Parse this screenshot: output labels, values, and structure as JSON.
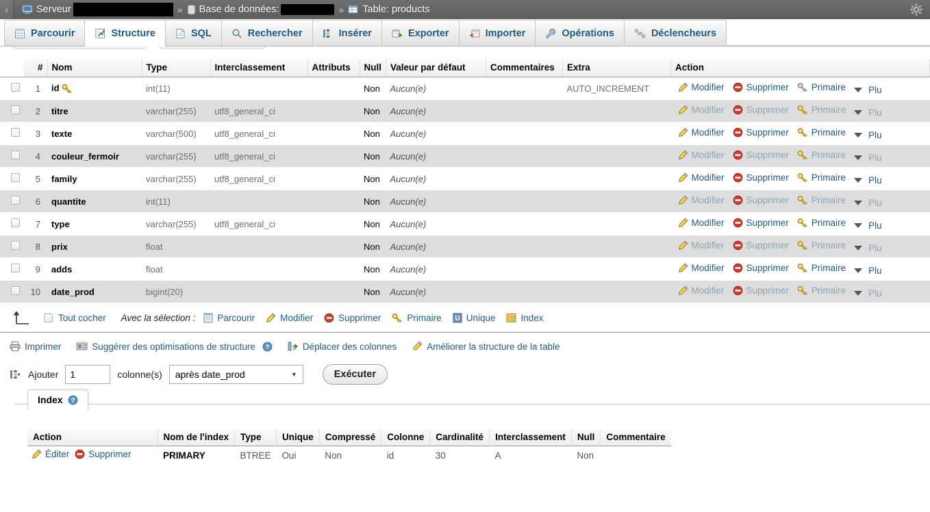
{
  "breadcrumb": {
    "back_label": "‹",
    "server_label": "Serveur",
    "server_value_redacted": true,
    "database_label": "Base de données:",
    "database_value_redacted": true,
    "table_label": "Table: products",
    "separator": "»",
    "settings_icon": "gear-icon"
  },
  "tabs": [
    {
      "label": "Parcourir",
      "icon": "browse-icon",
      "active": false
    },
    {
      "label": "Structure",
      "icon": "structure-icon",
      "active": true
    },
    {
      "label": "SQL",
      "icon": "sql-icon",
      "active": false
    },
    {
      "label": "Rechercher",
      "icon": "search-icon",
      "active": false
    },
    {
      "label": "Insérer",
      "icon": "insert-icon",
      "active": false
    },
    {
      "label": "Exporter",
      "icon": "export-icon",
      "active": false
    },
    {
      "label": "Importer",
      "icon": "import-icon",
      "active": false
    },
    {
      "label": "Opérations",
      "icon": "wrench-icon",
      "active": false
    },
    {
      "label": "Déclencheurs",
      "icon": "trigger-icon",
      "active": false
    }
  ],
  "structure_table": {
    "headers": [
      "",
      "#",
      "Nom",
      "Type",
      "Interclassement",
      "Attributs",
      "Null",
      "Valeur par défaut",
      "Commentaires",
      "Extra",
      "Action"
    ],
    "rows": [
      {
        "num": "1",
        "name": "id",
        "key": true,
        "type": "int(11)",
        "collation": "",
        "attributes": "",
        "null": "Non",
        "default": "Aucun(e)",
        "comments": "",
        "extra": "AUTO_INCREMENT",
        "primary_dim": true
      },
      {
        "num": "2",
        "name": "titre",
        "key": false,
        "type": "varchar(255)",
        "collation": "utf8_general_ci",
        "attributes": "",
        "null": "Non",
        "default": "Aucun(e)",
        "comments": "",
        "extra": "",
        "primary_dim": false
      },
      {
        "num": "3",
        "name": "texte",
        "key": false,
        "type": "varchar(500)",
        "collation": "utf8_general_ci",
        "attributes": "",
        "null": "Non",
        "default": "Aucun(e)",
        "comments": "",
        "extra": "",
        "primary_dim": false
      },
      {
        "num": "4",
        "name": "couleur_fermoir",
        "key": false,
        "type": "varchar(255)",
        "collation": "utf8_general_ci",
        "attributes": "",
        "null": "Non",
        "default": "Aucun(e)",
        "comments": "",
        "extra": "",
        "primary_dim": false
      },
      {
        "num": "5",
        "name": "family",
        "key": false,
        "type": "varchar(255)",
        "collation": "utf8_general_ci",
        "attributes": "",
        "null": "Non",
        "default": "Aucun(e)",
        "comments": "",
        "extra": "",
        "primary_dim": false
      },
      {
        "num": "6",
        "name": "quantite",
        "key": false,
        "type": "int(11)",
        "collation": "",
        "attributes": "",
        "null": "Non",
        "default": "Aucun(e)",
        "comments": "",
        "extra": "",
        "primary_dim": false
      },
      {
        "num": "7",
        "name": "type",
        "key": false,
        "type": "varchar(255)",
        "collation": "utf8_general_ci",
        "attributes": "",
        "null": "Non",
        "default": "Aucun(e)",
        "comments": "",
        "extra": "",
        "primary_dim": false
      },
      {
        "num": "8",
        "name": "prix",
        "key": false,
        "type": "float",
        "collation": "",
        "attributes": "",
        "null": "Non",
        "default": "Aucun(e)",
        "comments": "",
        "extra": "",
        "primary_dim": false
      },
      {
        "num": "9",
        "name": "adds",
        "key": false,
        "type": "float",
        "collation": "",
        "attributes": "",
        "null": "Non",
        "default": "Aucun(e)",
        "comments": "",
        "extra": "",
        "primary_dim": false
      },
      {
        "num": "10",
        "name": "date_prod",
        "key": false,
        "type": "bigint(20)",
        "collation": "",
        "attributes": "",
        "null": "Non",
        "default": "Aucun(e)",
        "comments": "",
        "extra": "",
        "primary_dim": false
      }
    ],
    "row_actions": {
      "edit": "Modifier",
      "drop": "Supprimer",
      "primary": "Primaire",
      "more": "Plu"
    }
  },
  "selection_bar": {
    "check_all": "Tout cocher",
    "with_selected": "Avec la sélection :",
    "actions": [
      {
        "label": "Parcourir",
        "icon": "browse-icon"
      },
      {
        "label": "Modifier",
        "icon": "pencil-icon"
      },
      {
        "label": "Supprimer",
        "icon": "delete-icon"
      },
      {
        "label": "Primaire",
        "icon": "key-icon"
      },
      {
        "label": "Unique",
        "icon": "unique-icon"
      },
      {
        "label": "Index",
        "icon": "index-icon"
      }
    ]
  },
  "links_bar": [
    {
      "label": "Imprimer",
      "icon": "print-icon",
      "help": false
    },
    {
      "label": "Suggérer des optimisations de structure",
      "icon": "optimize-icon",
      "help": true
    },
    {
      "label": "Déplacer des colonnes",
      "icon": "move-columns-icon",
      "help": false
    },
    {
      "label": "Améliorer la structure de la table",
      "icon": "magic-wand-icon",
      "help": false
    }
  ],
  "add_column_form": {
    "icon": "add-column-icon",
    "add_label": "Ajouter",
    "count_value": "1",
    "columns_label": "colonne(s)",
    "position_value": "après date_prod",
    "execute_label": "Exécuter"
  },
  "index_panel": {
    "tab_label": "Index",
    "help_icon": "help-icon",
    "headers": [
      "Action",
      "Nom de l'index",
      "Type",
      "Unique",
      "Compressé",
      "Colonne",
      "Cardinalité",
      "Interclassement",
      "Null",
      "Commentaire"
    ],
    "rows": [
      {
        "edit": "Éditer",
        "drop": "Supprimer",
        "index_name": "PRIMARY",
        "type": "BTREE",
        "unique": "Oui",
        "compressed": "Non",
        "column": "id",
        "cardinality": "30",
        "collation": "A",
        "null": "Non",
        "comment": ""
      }
    ]
  },
  "colors": {
    "link": "#235a81",
    "breadcrumb_bg": "#666666",
    "row_even_bg": "#dddddd",
    "row_odd_bg": "#ffffff",
    "header_bg": "#eeeeee"
  }
}
